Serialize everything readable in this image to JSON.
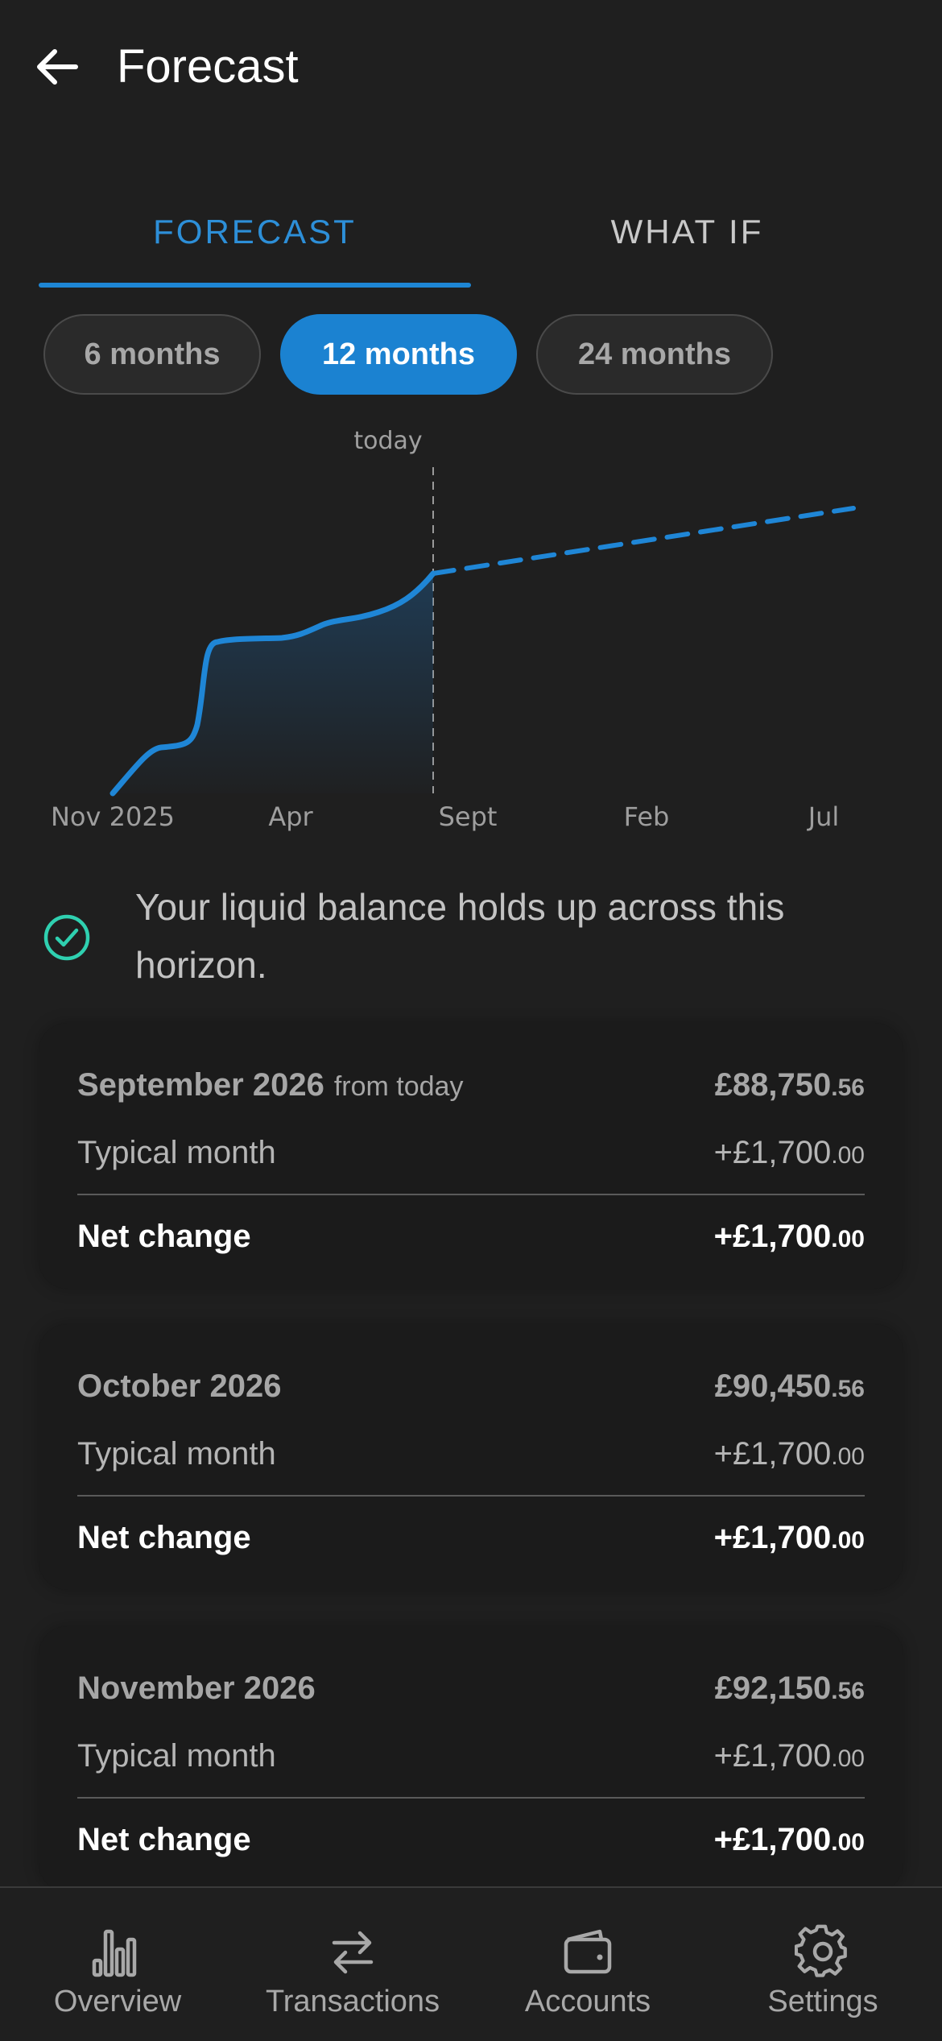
{
  "header": {
    "title": "Forecast",
    "back_icon": "arrow-left-icon"
  },
  "tabs": [
    {
      "label": "FORECAST",
      "active": true
    },
    {
      "label": "WHAT IF",
      "active": false
    }
  ],
  "ranges": [
    {
      "label": "6 months",
      "selected": false
    },
    {
      "label": "12 months",
      "selected": true
    },
    {
      "label": "24 months",
      "selected": false
    }
  ],
  "chart_data": {
    "type": "line",
    "today_label": "today",
    "x_ticks": [
      "Nov 2025",
      "Apr",
      "Sept",
      "Feb",
      "Jul"
    ],
    "colors": {
      "line": "#1f86d6",
      "marker": "#9a9a9a"
    }
  },
  "status": {
    "icon": "check-circle-icon",
    "color": "#2fd0b0",
    "text": "Your liquid balance holds up across this horizon."
  },
  "months": [
    {
      "month": "September 2026",
      "note": "from today",
      "balance_main": "£88,750",
      "balance_cents": ".56",
      "typical_label": "Typical month",
      "typical_main": "+£1,700",
      "typical_cents": ".00",
      "net_label": "Net change",
      "net_main": "+£1,700",
      "net_cents": ".00"
    },
    {
      "month": "October 2026",
      "note": "",
      "balance_main": "£90,450",
      "balance_cents": ".56",
      "typical_label": "Typical month",
      "typical_main": "+£1,700",
      "typical_cents": ".00",
      "net_label": "Net change",
      "net_main": "+£1,700",
      "net_cents": ".00"
    },
    {
      "month": "November 2026",
      "note": "",
      "balance_main": "£92,150",
      "balance_cents": ".56",
      "typical_label": "Typical month",
      "typical_main": "+£1,700",
      "typical_cents": ".00",
      "net_label": "Net change",
      "net_main": "+£1,700",
      "net_cents": ".00"
    }
  ],
  "nav": [
    {
      "label": "Overview",
      "icon": "bar-chart-icon"
    },
    {
      "label": "Transactions",
      "icon": "swap-arrows-icon"
    },
    {
      "label": "Accounts",
      "icon": "wallet-icon"
    },
    {
      "label": "Settings",
      "icon": "gear-icon"
    }
  ]
}
